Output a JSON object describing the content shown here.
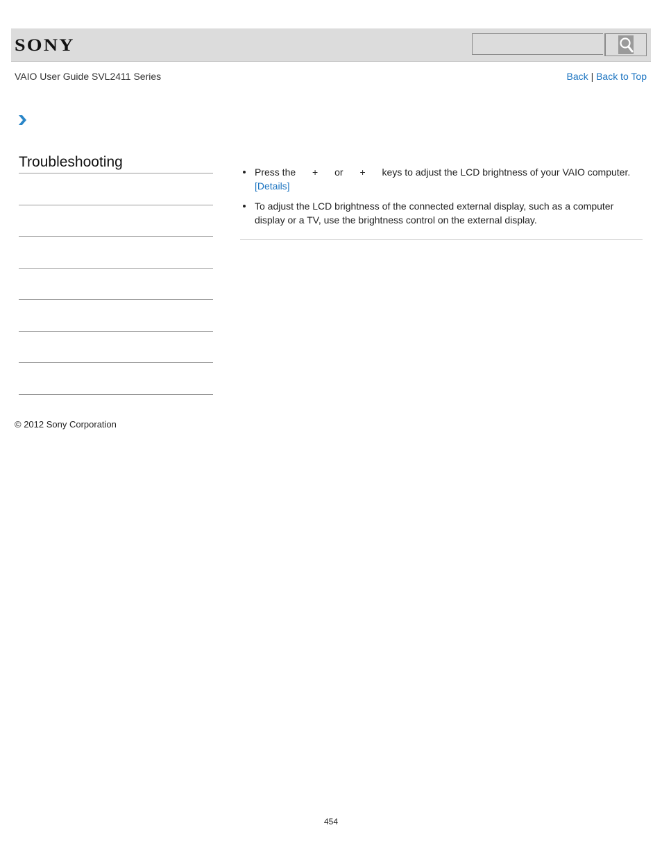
{
  "header": {
    "logo": "SONY",
    "search": {
      "value": "",
      "placeholder": ""
    },
    "search_icon": "search-icon"
  },
  "nav": {
    "guide_title": "VAIO User Guide SVL2411 Series",
    "back_label": "Back",
    "separator": "|",
    "back_to_top_label": "Back to Top"
  },
  "breadcrumb": {
    "icon": "chevron-right-icon"
  },
  "sidebar": {
    "title": "Troubleshooting",
    "items": [
      "",
      "",
      "",
      "",
      "",
      "",
      ""
    ]
  },
  "content": {
    "items": [
      {
        "parts": [
          "Press the",
          "+",
          "or",
          "+",
          "keys to adjust the LCD brightness of your VAIO computer."
        ],
        "link": "[Details]"
      },
      {
        "text": "To adjust the LCD brightness of the connected external display, such as a computer display or a TV, use the brightness control on the external display."
      }
    ]
  },
  "footer": {
    "copyright": "© 2012 Sony Corporation",
    "page_number": "454"
  },
  "colors": {
    "header_bg": "#dcdcdc",
    "link": "#1a73c0",
    "chevron": "#2a86c8"
  }
}
